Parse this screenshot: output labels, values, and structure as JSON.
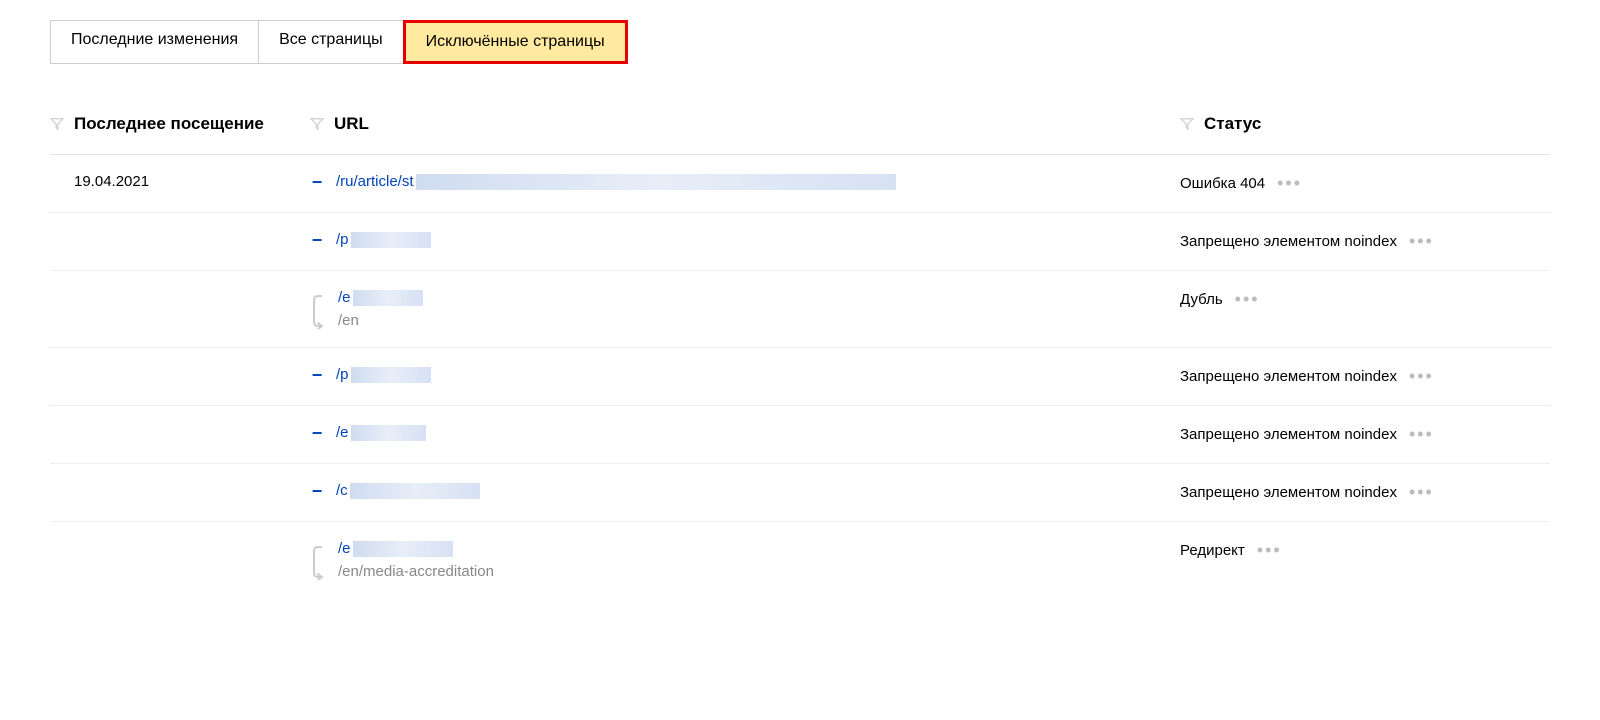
{
  "tabs": {
    "recent_changes": "Последние изменения",
    "all_pages": "Все страницы",
    "excluded_pages": "Исключённые страницы"
  },
  "columns": {
    "date": "Последнее посещение",
    "url": "URL",
    "status": "Статус"
  },
  "date_group": "19.04.2021",
  "rows": [
    {
      "type": "minus",
      "url_visible": "/ru/article/st",
      "redacted_width": 480,
      "status": "Ошибка 404"
    },
    {
      "type": "minus",
      "url_visible": "/p",
      "redacted_width": 80,
      "status": "Запрещено элементом noindex"
    },
    {
      "type": "redirect",
      "url_visible": "/e",
      "redacted_width": 70,
      "redirect_to": "/en",
      "status": "Дубль"
    },
    {
      "type": "minus",
      "url_visible": "/p",
      "redacted_width": 80,
      "status": "Запрещено элементом noindex"
    },
    {
      "type": "minus",
      "url_visible": "/e",
      "redacted_width": 75,
      "status": "Запрещено элементом noindex"
    },
    {
      "type": "minus",
      "url_visible": "/c",
      "redacted_width": 130,
      "status": "Запрещено элементом noindex"
    },
    {
      "type": "redirect",
      "url_visible": "/e",
      "redacted_width": 100,
      "redirect_to": "/en/media-accreditation",
      "status": "Редирект"
    }
  ]
}
